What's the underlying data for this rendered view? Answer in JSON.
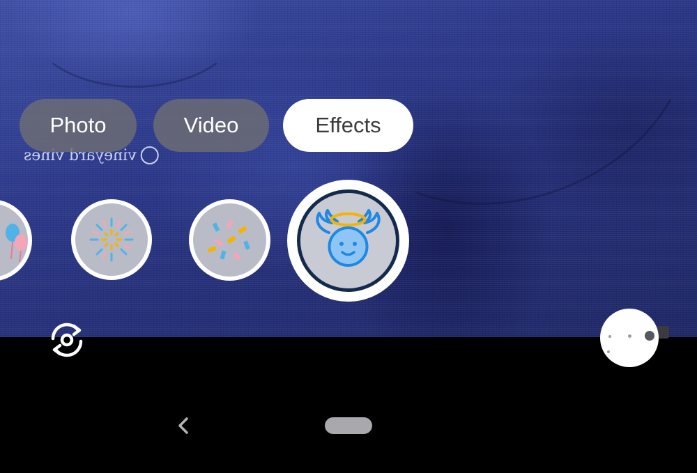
{
  "mode_tabs": [
    {
      "label": "Photo",
      "state": "inactive"
    },
    {
      "label": "Video",
      "state": "inactive"
    },
    {
      "label": "Effects",
      "state": "active"
    }
  ],
  "effects": [
    {
      "name": "balloons",
      "selected": false
    },
    {
      "name": "fireworks",
      "selected": false
    },
    {
      "name": "confetti",
      "selected": false
    },
    {
      "name": "angel-halo-wings",
      "selected": true
    }
  ],
  "viewfinder": {
    "shirt_logo_text": "vineyard vines"
  },
  "controls": {
    "switch_camera_icon": "switch-camera-icon",
    "gallery_icon": "gallery-thumbnail",
    "nav_back_icon": "back-chevron-icon",
    "nav_home_icon": "home-pill"
  },
  "colors": {
    "active_tab_bg": "#ffffff",
    "inactive_tab_bg": "#6e6e73",
    "accent_blue": "#1e88e5",
    "halo_yellow": "#f4b400",
    "effect_tile_bg": "#b9bbc6"
  }
}
